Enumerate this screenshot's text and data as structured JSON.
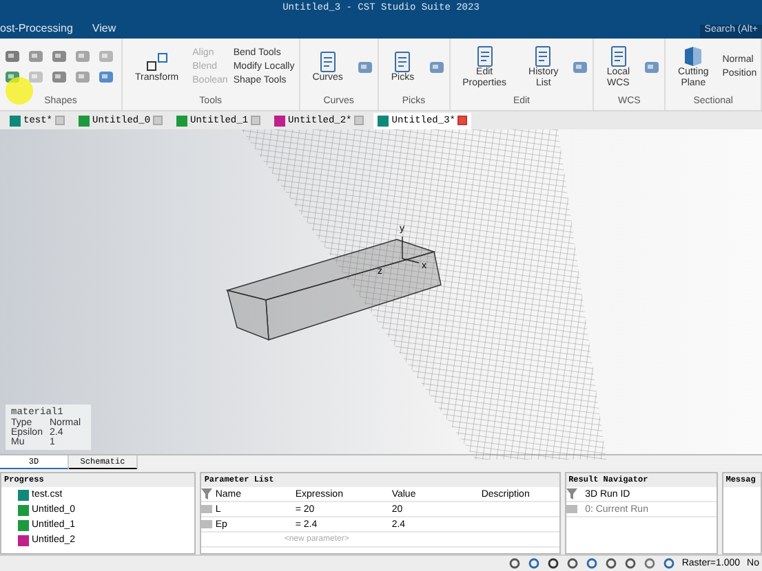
{
  "window": {
    "title": "Untitled_3 - CST Studio Suite 2023"
  },
  "menu": [
    "ost-Processing",
    "View"
  ],
  "search": {
    "placeholder": "Search (Alt+"
  },
  "ribbon": {
    "groups": [
      {
        "label": "Shapes",
        "kind": "icons"
      },
      {
        "label": "Tools",
        "kind": "tools",
        "big": "Transform",
        "items": [
          {
            "label": "Align",
            "disabled": true
          },
          {
            "label": "Blend",
            "disabled": true
          },
          {
            "label": "Boolean",
            "disabled": true
          },
          {
            "label": "Bend Tools",
            "disabled": false
          },
          {
            "label": "Modify Locally",
            "disabled": false
          },
          {
            "label": "Shape Tools",
            "disabled": false
          }
        ]
      },
      {
        "label": "Curves",
        "kind": "big",
        "buttons": [
          "Curves"
        ]
      },
      {
        "label": "Picks",
        "kind": "big",
        "buttons": [
          "Picks"
        ]
      },
      {
        "label": "Edit",
        "kind": "big",
        "buttons": [
          "Edit Properties",
          "History List"
        ]
      },
      {
        "label": "WCS",
        "kind": "big",
        "buttons": [
          "Local WCS"
        ]
      },
      {
        "label": "Sectional",
        "kind": "section",
        "buttons": [
          "Cutting Plane"
        ],
        "options": [
          "Normal",
          "Position"
        ]
      }
    ]
  },
  "doc_tabs": [
    {
      "label": "test*",
      "color": "#11897a",
      "selected": false
    },
    {
      "label": "Untitled_0",
      "color": "#1d9a3c",
      "selected": false
    },
    {
      "label": "Untitled_1",
      "color": "#1d9a3c",
      "selected": false
    },
    {
      "label": "Untitled_2*",
      "color": "#c0208a",
      "selected": false
    },
    {
      "label": "Untitled_3*",
      "color": "#11897a",
      "selected": true
    }
  ],
  "viewport": {
    "axes": [
      "y",
      "x",
      "z"
    ],
    "material": {
      "name": "material1",
      "props": [
        {
          "key": "Type",
          "value": "Normal"
        },
        {
          "key": "Epsilon",
          "value": "2.4"
        },
        {
          "key": "Mu",
          "value": "1"
        }
      ]
    }
  },
  "view_tabs": [
    {
      "label": "3D",
      "selected": true
    },
    {
      "label": "Schematic",
      "selected": false
    }
  ],
  "progress": {
    "title": "Progress",
    "items": [
      {
        "label": "test.cst",
        "color": "#11897a"
      },
      {
        "label": "Untitled_0",
        "color": "#1d9a3c"
      },
      {
        "label": "Untitled_1",
        "color": "#1d9a3c"
      },
      {
        "label": "Untitled_2",
        "color": "#c0208a"
      }
    ]
  },
  "parameters": {
    "title": "Parameter List",
    "columns": [
      "Name",
      "Expression",
      "Value",
      "Description"
    ],
    "rows": [
      {
        "name": "L",
        "expression": "= 20",
        "value": "20"
      },
      {
        "name": "Ep",
        "expression": "= 2.4",
        "value": "2.4"
      }
    ],
    "placeholder": "<new parameter>"
  },
  "results": {
    "title": "Result Navigator",
    "column": "3D Run ID",
    "rows": [
      "0: Current Run"
    ]
  },
  "messages": {
    "title": "Messag"
  },
  "status_bar": {
    "raster": "Raster=1.000",
    "mode": "No"
  }
}
